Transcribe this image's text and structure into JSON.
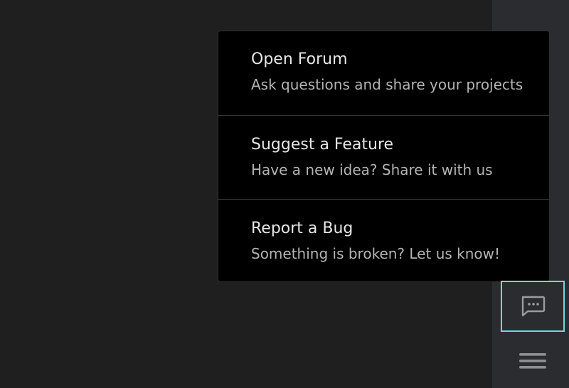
{
  "feedback_menu": {
    "items": [
      {
        "title": "Open Forum",
        "description": "Ask questions and share your projects"
      },
      {
        "title": "Suggest a Feature",
        "description": "Have a new idea? Share it with us"
      },
      {
        "title": "Report a Bug",
        "description": "Something is broken? Let us know!"
      }
    ]
  },
  "right_rail": {
    "feedback_icon": "chat-bubble-ellipsis-icon",
    "menu_icon": "hamburger-menu-icon",
    "focus_color": "#6fd8dd"
  },
  "colors": {
    "background": "#1f1f20",
    "rail": "#2b2c2f",
    "menu_background": "#000000",
    "title_text": "#e6e6e6",
    "description_text": "#b3b3b3"
  }
}
